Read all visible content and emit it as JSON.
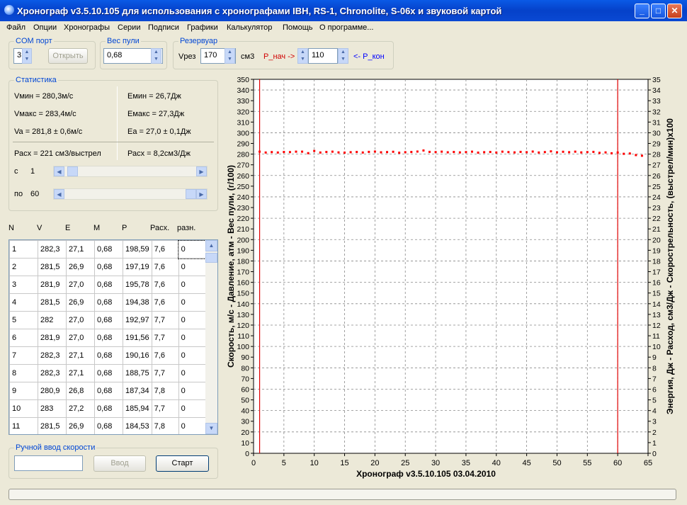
{
  "window": {
    "title": "Хронограф v3.5.10.105  для использования с хронографами  IBH, RS-1, Chronolite, S-06x и звуковой картой",
    "minimize_icon": "minimize-icon",
    "maximize_icon": "maximize-icon",
    "close_icon": "close-icon"
  },
  "menu": [
    "Файл",
    "Опции",
    "Хронографы",
    "Серии",
    "Подписи",
    "Графики",
    "Калькулятор",
    "Помощь",
    "О программе..."
  ],
  "com": {
    "legend": "COM порт",
    "value": "3",
    "open_label": "Открыть"
  },
  "weight": {
    "legend": "Вес пули",
    "value": "0,68"
  },
  "reservoir": {
    "legend": "Резервуар",
    "vrez_label": "Vрез",
    "vrez_value": "170",
    "unit": "см3",
    "p_start_label": "P_нач ->",
    "p_value": "110",
    "p_end_label": "<- P_кон"
  },
  "stats": {
    "legend": "Статистика",
    "vmin": "Vмин = 280,3м/с",
    "vmax": "Vмакс = 283,4м/с",
    "va": "Va = 281,8 ± 0,6м/с",
    "emin": "Емин = 26,7Дж",
    "emax": "Емакс = 27,3Дж",
    "ea": "Еа = 27,0 ± 0,1Дж",
    "rash1": "Расх = 221 см3/выстрел",
    "rash2": "Расх = 8,2см3/Дж",
    "from_label": "с",
    "from_value": "1",
    "to_label": "по",
    "to_value": "60",
    "from_slider": 0.0,
    "to_slider": 1.0
  },
  "table": {
    "headers": [
      "N",
      "V",
      "E",
      "M",
      "P",
      "Расх.",
      "разн."
    ],
    "rows": [
      [
        "1",
        "282,3",
        "27,1",
        "0,68",
        "198,59",
        "7,6",
        "0"
      ],
      [
        "2",
        "281,5",
        "26,9",
        "0,68",
        "197,19",
        "7,6",
        "0"
      ],
      [
        "3",
        "281,9",
        "27,0",
        "0,68",
        "195,78",
        "7,6",
        "0"
      ],
      [
        "4",
        "281,5",
        "26,9",
        "0,68",
        "194,38",
        "7,6",
        "0"
      ],
      [
        "5",
        "282",
        "27,0",
        "0,68",
        "192,97",
        "7,7",
        "0"
      ],
      [
        "6",
        "281,9",
        "27,0",
        "0,68",
        "191,56",
        "7,7",
        "0"
      ],
      [
        "7",
        "282,3",
        "27,1",
        "0,68",
        "190,16",
        "7,6",
        "0"
      ],
      [
        "8",
        "282,3",
        "27,1",
        "0,68",
        "188,75",
        "7,7",
        "0"
      ],
      [
        "9",
        "280,9",
        "26,8",
        "0,68",
        "187,34",
        "7,8",
        "0"
      ],
      [
        "10",
        "283",
        "27,2",
        "0,68",
        "185,94",
        "7,7",
        "0"
      ],
      [
        "11",
        "281,5",
        "26,9",
        "0,68",
        "184,53",
        "7,8",
        "0"
      ]
    ]
  },
  "manual": {
    "legend": "Ручной ввод скорости",
    "input_value": "",
    "enter_label": "Ввод",
    "start_label": "Старт"
  },
  "chart_data": {
    "type": "scatter",
    "xlim": [
      0,
      65
    ],
    "ylim": [
      0,
      350
    ],
    "y2lim": [
      0,
      35
    ],
    "x_ticks": [
      0,
      5,
      10,
      15,
      20,
      25,
      30,
      35,
      40,
      45,
      50,
      55,
      60,
      65
    ],
    "y_ticks": [
      0,
      10,
      20,
      30,
      40,
      50,
      60,
      70,
      80,
      90,
      100,
      110,
      120,
      130,
      140,
      150,
      160,
      170,
      180,
      190,
      200,
      210,
      220,
      230,
      240,
      250,
      260,
      270,
      280,
      290,
      300,
      310,
      320,
      330,
      340,
      350
    ],
    "y2_ticks": [
      0,
      1,
      2,
      3,
      4,
      5,
      6,
      7,
      8,
      9,
      10,
      11,
      12,
      13,
      14,
      15,
      16,
      17,
      18,
      19,
      20,
      21,
      22,
      23,
      24,
      25,
      26,
      27,
      28,
      29,
      30,
      31,
      32,
      33,
      34,
      35
    ],
    "ylabel": "Скорость, м/с  - Давление, атм - Вес пули, (г/100)",
    "y2label": "Энергия, Дж  -  Расход, см3/Дж - Скорострельность, (выстрел/мин)x100",
    "footer": "Хронограф v3.5.10.105      03.04.2010",
    "grid": true,
    "marker_lines_x": [
      1,
      60
    ],
    "series": [
      {
        "color": "#ff0000",
        "x": [
          1,
          2,
          3,
          4,
          5,
          6,
          7,
          8,
          9,
          10,
          11,
          12,
          13,
          14,
          15,
          16,
          17,
          18,
          19,
          20,
          21,
          22,
          23,
          24,
          25,
          26,
          27,
          28,
          29,
          30,
          31,
          32,
          33,
          34,
          35,
          36,
          37,
          38,
          39,
          40,
          41,
          42,
          43,
          44,
          45,
          46,
          47,
          48,
          49,
          50,
          51,
          52,
          53,
          54,
          55,
          56,
          57,
          58,
          59,
          60,
          61,
          62,
          63,
          64
        ],
        "values": [
          282.3,
          281.5,
          281.9,
          281.5,
          282,
          281.9,
          282.3,
          282.3,
          280.9,
          283,
          281.5,
          282,
          282.3,
          281.6,
          281.4,
          281.8,
          282,
          281.5,
          282.1,
          282.4,
          281.7,
          281.9,
          282.2,
          281.3,
          281.8,
          282,
          282.4,
          283.4,
          282.1,
          281.9,
          282.3,
          281.7,
          282,
          281.6,
          281.9,
          282.3,
          281.4,
          281.8,
          282,
          281.5,
          282.3,
          281.9,
          281.6,
          282.1,
          281.8,
          282.4,
          281.5,
          281.9,
          282.6,
          281.7,
          282.2,
          281.8,
          282.3,
          281.6,
          281.9,
          282.1,
          281.2,
          281.6,
          280.8,
          281.5,
          280.3,
          280.6,
          279.1,
          278.5
        ]
      }
    ]
  }
}
